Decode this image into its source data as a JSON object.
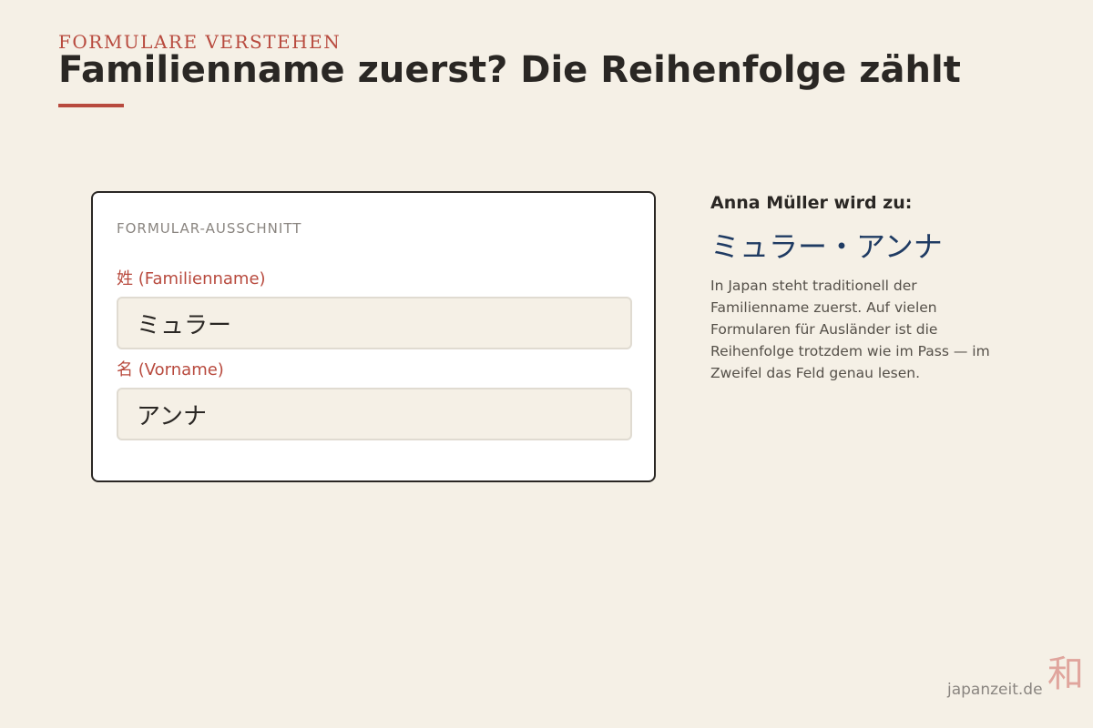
{
  "header": {
    "kicker": "FORMULARE VERSTEHEN",
    "title": "Familienname zuerst? Die Reihenfolge zählt"
  },
  "form": {
    "caption": "FORMULAR-AUSSCHNITT",
    "family_name_label": "姓 (Familienname)",
    "family_name_value": "ミュラー",
    "given_name_label": "名 (Vorname)",
    "given_name_value": "アンナ"
  },
  "sidebar": {
    "heading": "Anna Müller wird zu:",
    "transcription": "ミュラー・アンナ",
    "body": "In Japan steht traditionell der Familienname zuerst. Auf vielen Formularen für Ausländer ist die Reihenfolge trotzdem wie im Pass — im Zweifel das Feld genau lesen."
  },
  "footer": {
    "brand_mark": "和",
    "site": "japanzeit.de"
  },
  "colors": {
    "background": "#f5f0e6",
    "accent": "#b84a3e",
    "text": "#2a2724",
    "transcription": "#1f3b63"
  }
}
